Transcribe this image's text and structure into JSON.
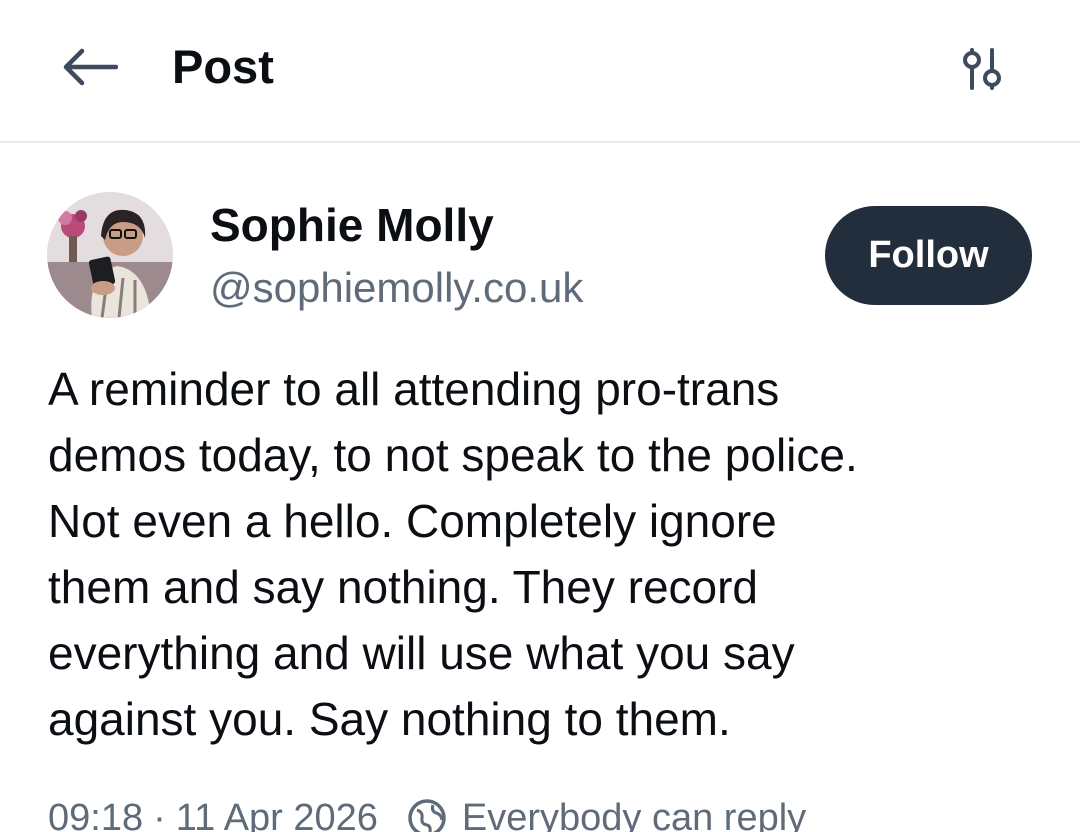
{
  "header": {
    "title": "Post",
    "back_icon": "arrow-left-icon",
    "settings_icon": "sliders-icon"
  },
  "post": {
    "author": {
      "display_name": "Sophie Molly",
      "handle": "@sophiemolly.co.uk",
      "avatar": "avatar-photo"
    },
    "follow_label": "Follow",
    "text_lines": [
      "A reminder to all attending pro-trans",
      "demos today, to not speak to the police.",
      "Not even a hello. Completely ignore",
      "them and say nothing. They record",
      "everything and will use what you say",
      "against you. Say nothing to them."
    ],
    "time": "09:18",
    "separator": "·",
    "date": "11 Apr 2026",
    "reply_setting_icon": "globe-icon",
    "reply_setting": "Everybody can reply"
  },
  "colors": {
    "text_primary": "#0b0f14",
    "text_secondary": "#5f6b78",
    "follow_bg": "#222e3c",
    "follow_text": "#ffffff",
    "divider": "#e9ecef"
  }
}
